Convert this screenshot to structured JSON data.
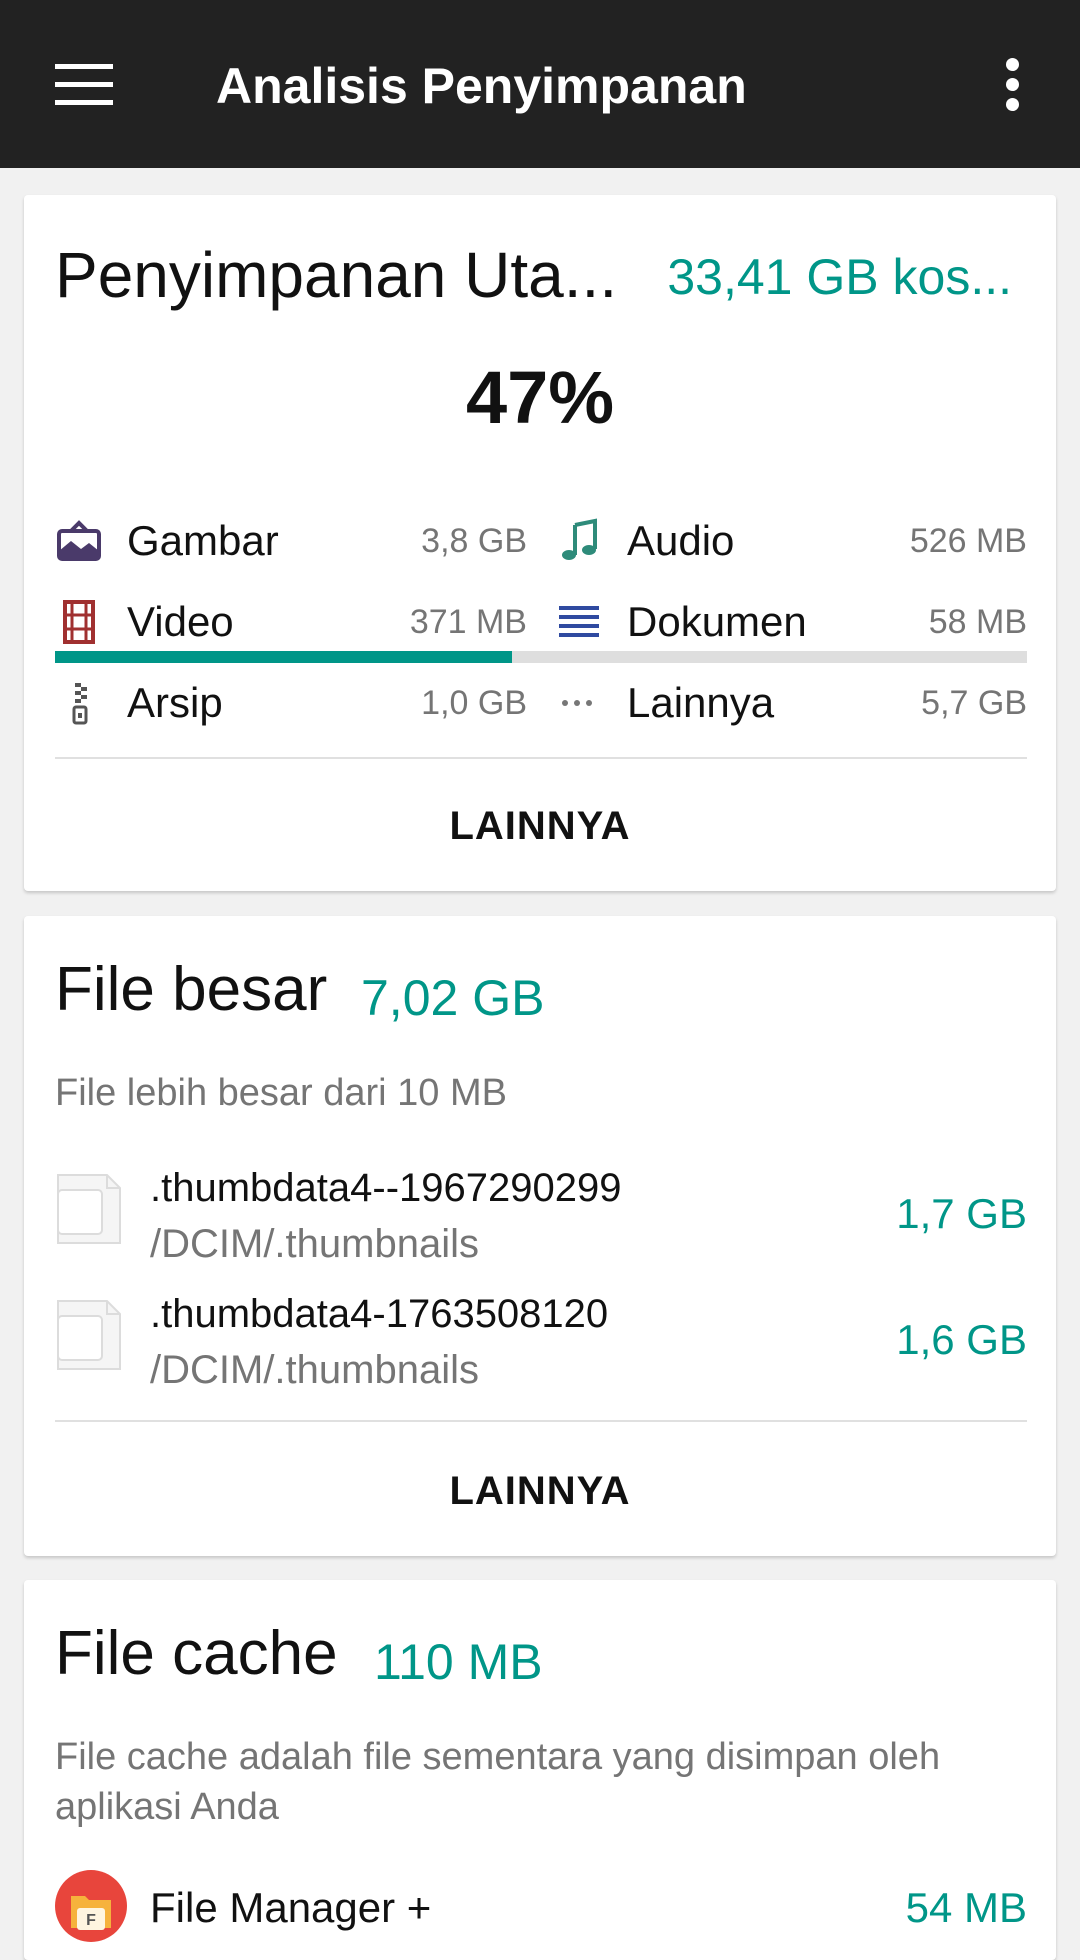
{
  "app_bar": {
    "title": "Analisis Penyimpanan",
    "menu_icon": "hamburger-menu-icon",
    "more_icon": "more-vert-icon"
  },
  "colors": {
    "accent": "#009688",
    "app_bar_bg": "#222222",
    "background": "#f1f1f1"
  },
  "storage": {
    "title": "Penyimpanan Uta...",
    "free": "33,41 GB kos...",
    "percent_text": "47%",
    "used_fraction": 0.47,
    "categories": [
      {
        "label": "Gambar",
        "size": "3,8 GB",
        "icon": "image-icon"
      },
      {
        "label": "Audio",
        "size": "526 MB",
        "icon": "music-note-icon"
      },
      {
        "label": "Video",
        "size": "371 MB",
        "icon": "film-icon"
      },
      {
        "label": "Dokumen",
        "size": "58 MB",
        "icon": "document-lines-icon"
      },
      {
        "label": "Arsip",
        "size": "1,0 GB",
        "icon": "zip-archive-icon"
      },
      {
        "label": "Lainnya",
        "size": "5,7 GB",
        "icon": "more-horiz-icon"
      }
    ],
    "more_label": "LAINNYA"
  },
  "large_files": {
    "title": "File besar",
    "total": "7,02 GB",
    "subtitle": "File lebih besar dari 10 MB",
    "files": [
      {
        "name": ".thumbdata4--1967290299",
        "path": "/DCIM/.thumbnails",
        "size": "1,7 GB"
      },
      {
        "name": ".thumbdata4-1763508120",
        "path": "/DCIM/.thumbnails",
        "size": "1,6 GB"
      }
    ],
    "more_label": "LAINNYA"
  },
  "cache": {
    "title": "File cache",
    "total": "110 MB",
    "subtitle": "File cache adalah file sementara yang disimpan oleh aplikasi Anda",
    "apps": [
      {
        "name": "File Manager +",
        "size": "54 MB",
        "icon": "file-manager-app-icon"
      }
    ]
  }
}
